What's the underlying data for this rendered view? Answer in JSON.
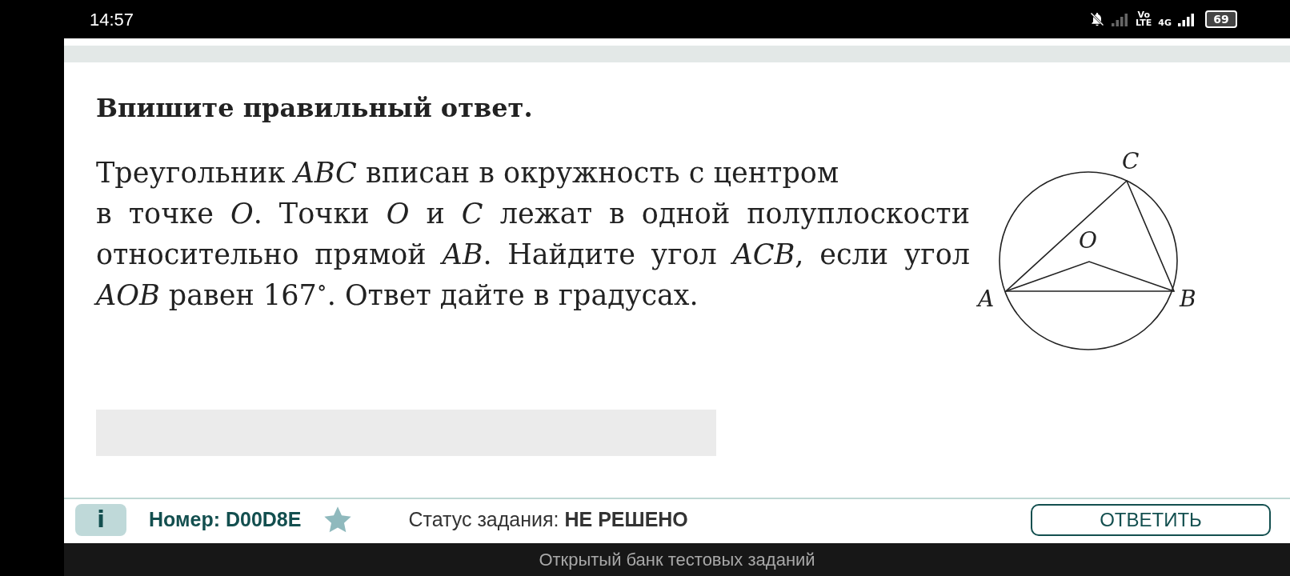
{
  "status_bar": {
    "time": "14:57",
    "network_top": "Vo",
    "network_bottom": "LTE",
    "network_type": "4G",
    "battery": "69"
  },
  "task": {
    "instruction": "Впишите правильный ответ.",
    "text": [
      "Треугольник *ABC* вписан в окружность с центром",
      "в точке *O*. Точки *O* и *C* лежат в одной полуплоскости относительно прямой *AB*. Найдите угол *ACB*, если угол *AOB* равен 167$^{∘}$. Ответ дайте в градусах."
    ],
    "diagram": {
      "points": [
        "A",
        "B",
        "C",
        "O"
      ]
    }
  },
  "footer": {
    "info": "i",
    "number": "Номер: D00D8E",
    "status_label": "Статус задания: ",
    "status_value": "НЕ РЕШЕНО",
    "submit": "ОТВЕТИТЬ"
  },
  "bottom_banner": "Открытый банк тестовых заданий"
}
